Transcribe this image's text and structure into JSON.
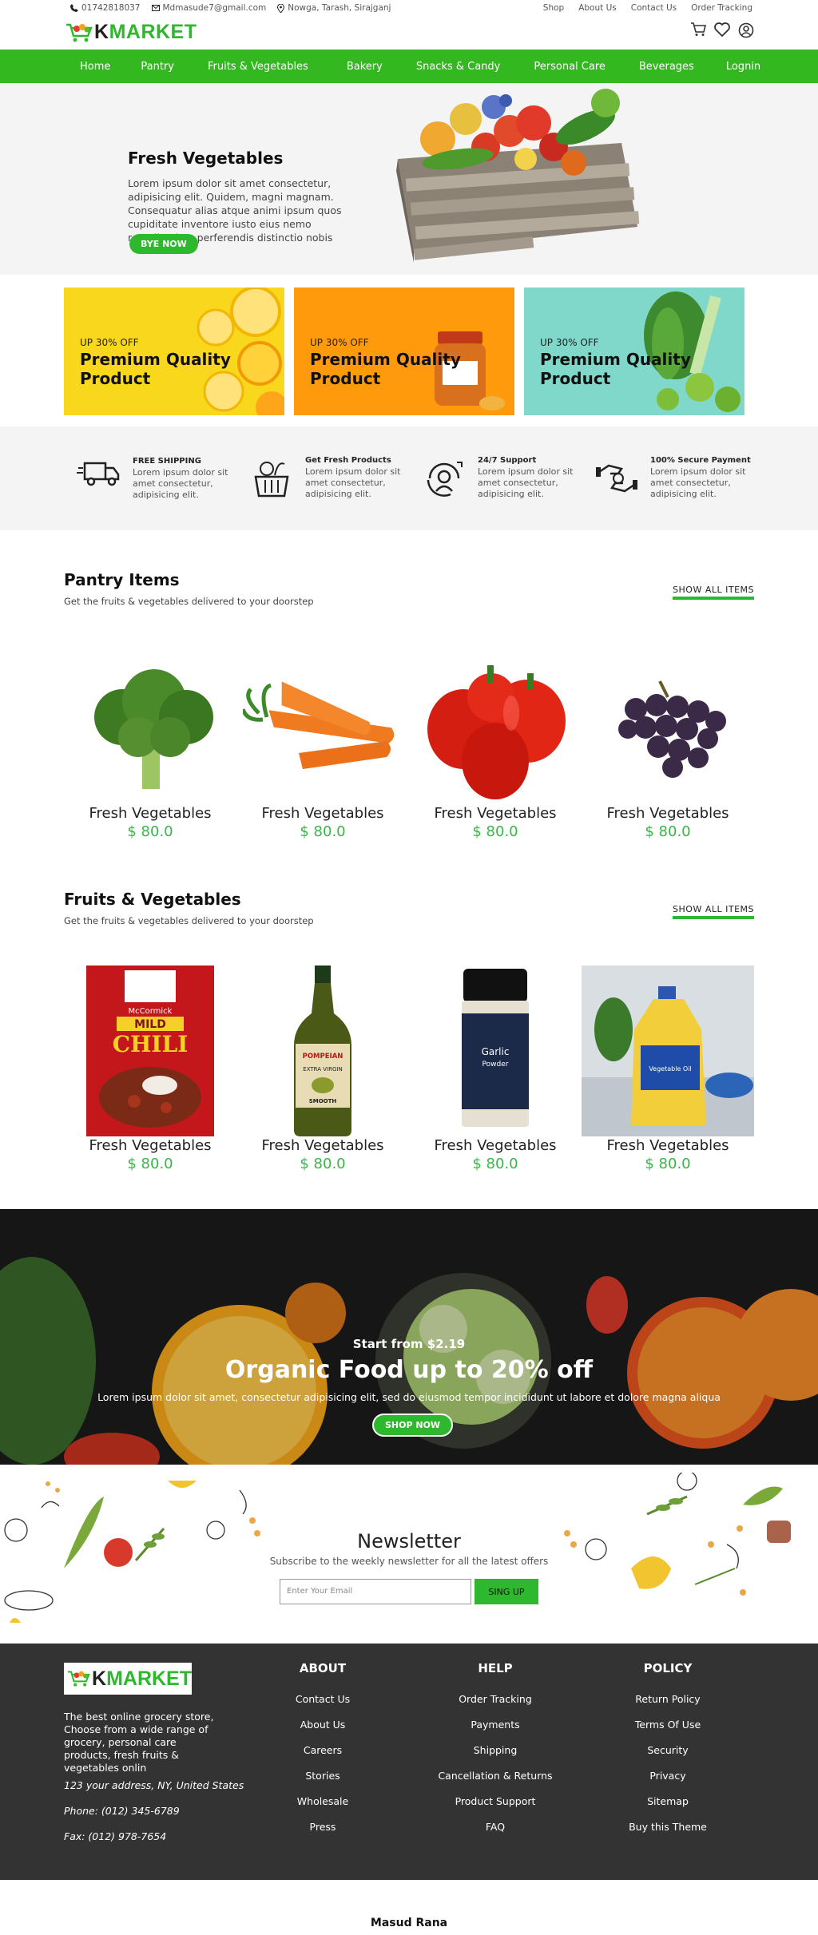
{
  "topbar": {
    "phone": "01742818037",
    "email": "Mdmasude7@gmail.com",
    "location": "Nowga, Tarash, Sirajganj",
    "links": [
      "Shop",
      "About Us",
      "Contact Us",
      "Order Tracking"
    ]
  },
  "brand": {
    "logo_k": "K",
    "logo_rest": "MARKET",
    "color": "#2db82d"
  },
  "nav": [
    "Home",
    "Pantry",
    "Fruits & Vegetables",
    "Bakery",
    "Snacks & Candy",
    "Personal Care",
    "Beverages",
    "Lognin"
  ],
  "hero": {
    "title": "Fresh Vegetables",
    "text": "Lorem ipsum dolor sit amet consectetur, adipisicing elit. Quidem, magni magnam. Consequatur alias atque animi ipsum quos cupiditate inventore iusto eius nemo repudiandae, perferendis distinctio nobis",
    "button": "BYE NOW"
  },
  "promos": [
    {
      "small": "UP 30% OFF",
      "big1": "Premium Quality",
      "big2": "Product",
      "bg": "#f9d71c"
    },
    {
      "small": "UP 30% OFF",
      "big1": "Premium Quality",
      "big2": "Product",
      "bg": "#ff9a0d"
    },
    {
      "small": "UP 30% OFF",
      "big1": "Premium Quality",
      "big2": "Product",
      "bg": "#7fd8c9"
    }
  ],
  "features": [
    {
      "title": "FREE SHIPPING",
      "desc": "Lorem ipsum dolor sit amet consectetur, adipisicing elit.",
      "icon": "truck-icon"
    },
    {
      "title": "Get Fresh Products",
      "desc": "Lorem ipsum dolor sit amet consectetur, adipisicing elit.",
      "icon": "basket-icon"
    },
    {
      "title": "24/7 Support",
      "desc": "Lorem ipsum dolor sit amet consectetur, adipisicing elit.",
      "icon": "support-icon"
    },
    {
      "title": "100% Secure Payment",
      "desc": "Lorem ipsum dolor sit amet consectetur, adipisicing elit.",
      "icon": "secure-payment-icon"
    }
  ],
  "pantry": {
    "title": "Pantry Items",
    "sub": "Get the fruits & vegetables delivered to your doorstep",
    "show": "SHOW ALL ITEMS",
    "items": [
      {
        "name": "Fresh Vegetables",
        "price": "$ 80.0",
        "img": "broccoli"
      },
      {
        "name": "Fresh Vegetables",
        "price": "$ 80.0",
        "img": "carrots"
      },
      {
        "name": "Fresh Vegetables",
        "price": "$ 80.0",
        "img": "peppers"
      },
      {
        "name": "Fresh Vegetables",
        "price": "$ 80.0",
        "img": "grapes"
      }
    ]
  },
  "fruits": {
    "title": "Fruits & Vegetables",
    "sub": "Get the fruits & vegetables delivered to your doorstep",
    "show": "SHOW ALL ITEMS",
    "items": [
      {
        "name": "Fresh Vegetables",
        "price": "$ 80.0",
        "img": "chili-pack"
      },
      {
        "name": "Fresh Vegetables",
        "price": "$ 80.0",
        "img": "olive-oil"
      },
      {
        "name": "Fresh Vegetables",
        "price": "$ 80.0",
        "img": "garlic-powder"
      },
      {
        "name": "Fresh Vegetables",
        "price": "$ 80.0",
        "img": "vegetable-oil"
      }
    ],
    "pkg_text": {
      "brand1": "McCormick",
      "mild": "MILD",
      "chili": "CHILI",
      "brand2": "POMPEIAN",
      "oil1": "EXTRA VIRGIN",
      "oil2": "SMOOTH",
      "garlic": "Garlic",
      "powder": "Powder",
      "veg": "Vegetable Oil"
    }
  },
  "banner": {
    "small": "Start from $2.19",
    "title": "Organic Food up to 20% off",
    "text": "Lorem ipsum dolor sit amet, consectetur adipisicing elit, sed do eiusmod tempor incididunt ut labore et dolore magna aliqua",
    "button": "SHOP NOW"
  },
  "newsletter": {
    "title": "Newsletter",
    "sub": "Subscribe to the weekly newsletter for all the latest offers",
    "placeholder": "Enter Your Email",
    "button": "SING UP"
  },
  "footer": {
    "about": "The best online grocery store, Choose from a wide range of grocery, personal care products, fresh fruits & vegetables onlin",
    "address": "123 your address, NY, United States",
    "phone": "Phone: (012) 345-6789",
    "fax": "Fax: (012) 978-7654",
    "cols": [
      {
        "title": "ABOUT",
        "links": [
          "Contact Us",
          "About Us",
          "Careers",
          "Stories",
          "Wholesale",
          "Press"
        ]
      },
      {
        "title": "HELP",
        "links": [
          "Order Tracking",
          "Payments",
          "Shipping",
          "Cancellation & Returns",
          "Product Support",
          "FAQ"
        ]
      },
      {
        "title": "POLICY",
        "links": [
          "Return Policy",
          "Terms Of Use",
          "Security",
          "Privacy",
          "Sitemap",
          "Buy this Theme"
        ]
      }
    ]
  },
  "credit": "Masud Rana"
}
